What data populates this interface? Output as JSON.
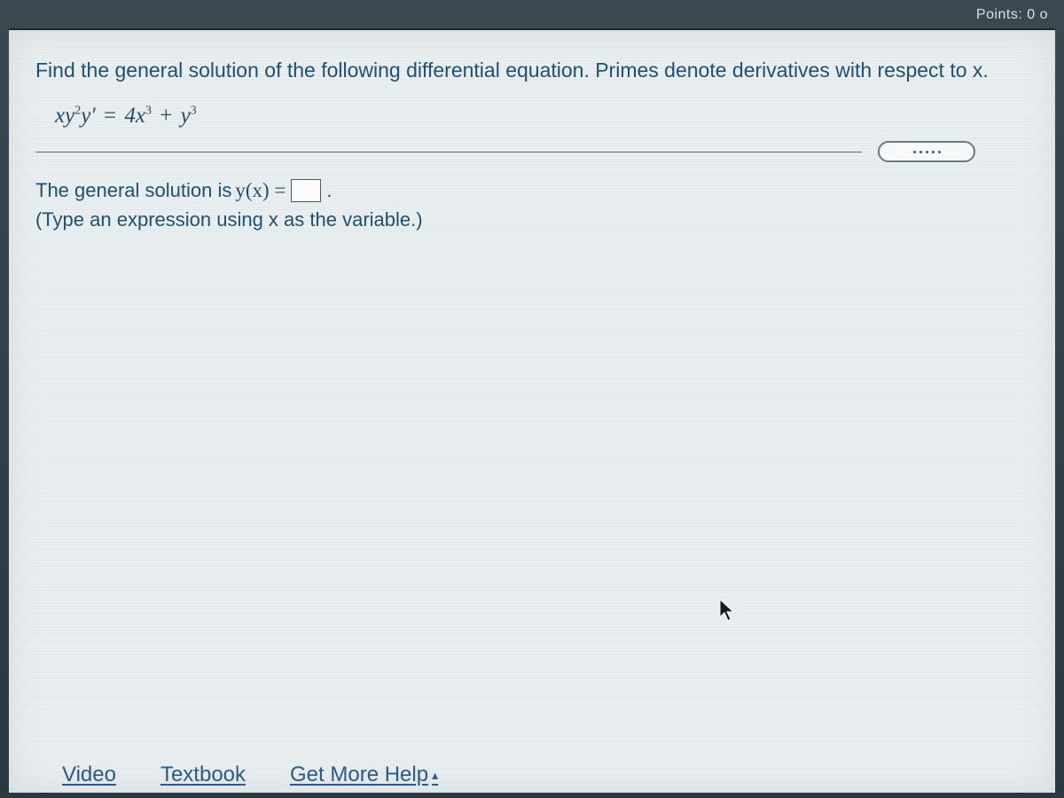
{
  "topbar": {
    "points_fragment": "Points: 0 o"
  },
  "question": {
    "prompt": "Find the general solution of the following differential equation. Primes denote derivatives with respect to x.",
    "equation": {
      "lhs_var1": "xy",
      "lhs_exp1": "2",
      "lhs_var2": "y′",
      "eq": " = ",
      "rhs_coef": "4x",
      "rhs_exp1": "3",
      "plus": " + ",
      "rhs_var2": "y",
      "rhs_exp2": "3"
    }
  },
  "solution": {
    "lead": "The general solution is ",
    "func": "y(x) = ",
    "trail": ".",
    "hint": "(Type an expression using x as the variable.)"
  },
  "links": {
    "video": "Video",
    "textbook": "Textbook",
    "more_help": "Get More Help"
  }
}
